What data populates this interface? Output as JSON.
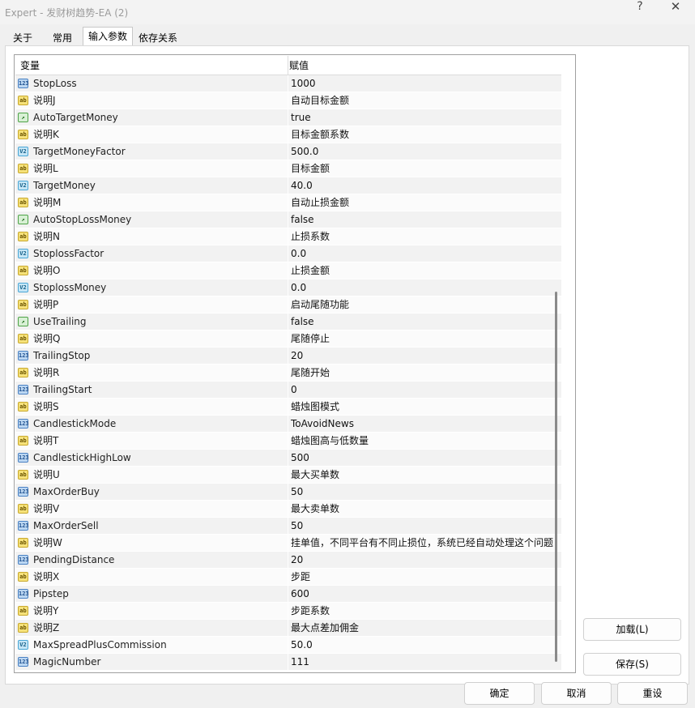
{
  "window": {
    "title": "Expert - 发财树趋势-EA (2)",
    "help_label": "?",
    "close_label": "✕"
  },
  "tabs": [
    {
      "label": "关于"
    },
    {
      "label": "常用"
    },
    {
      "label": "输入参数"
    },
    {
      "label": "依存关系"
    }
  ],
  "grid": {
    "col_variable": "变量",
    "col_value": "赋值",
    "rows": [
      {
        "name": "StopLoss",
        "value": "1000",
        "type": "int"
      },
      {
        "name": "说明J",
        "value": "自动目标金额",
        "type": "str"
      },
      {
        "name": "AutoTargetMoney",
        "value": "true",
        "type": "bool"
      },
      {
        "name": "说明K",
        "value": "目标金额系数",
        "type": "str"
      },
      {
        "name": "TargetMoneyFactor",
        "value": "500.0",
        "type": "dbl"
      },
      {
        "name": "说明L",
        "value": "目标金额",
        "type": "str"
      },
      {
        "name": "TargetMoney",
        "value": "40.0",
        "type": "dbl"
      },
      {
        "name": "说明M",
        "value": "自动止损金额",
        "type": "str"
      },
      {
        "name": "AutoStopLossMoney",
        "value": "false",
        "type": "bool"
      },
      {
        "name": "说明N",
        "value": "止损系数",
        "type": "str"
      },
      {
        "name": "StoplossFactor",
        "value": "0.0",
        "type": "dbl"
      },
      {
        "name": "说明O",
        "value": "止损金额",
        "type": "str"
      },
      {
        "name": "StoplossMoney",
        "value": "0.0",
        "type": "dbl"
      },
      {
        "name": "说明P",
        "value": "启动尾随功能",
        "type": "str"
      },
      {
        "name": "UseTrailing",
        "value": "false",
        "type": "bool"
      },
      {
        "name": "说明Q",
        "value": "尾随停止",
        "type": "str"
      },
      {
        "name": "TrailingStop",
        "value": "20",
        "type": "int"
      },
      {
        "name": "说明R",
        "value": "尾随开始",
        "type": "str"
      },
      {
        "name": "TrailingStart",
        "value": "0",
        "type": "int"
      },
      {
        "name": "说明S",
        "value": "蜡烛图模式",
        "type": "str"
      },
      {
        "name": "CandlestickMode",
        "value": "ToAvoidNews",
        "type": "int"
      },
      {
        "name": "说明T",
        "value": "蜡烛图高与低数量",
        "type": "str"
      },
      {
        "name": "CandlestickHighLow",
        "value": "500",
        "type": "int"
      },
      {
        "name": "说明U",
        "value": "最大买单数",
        "type": "str"
      },
      {
        "name": "MaxOrderBuy",
        "value": "50",
        "type": "int"
      },
      {
        "name": "说明V",
        "value": "最大卖单数",
        "type": "str"
      },
      {
        "name": "MaxOrderSell",
        "value": "50",
        "type": "int"
      },
      {
        "name": "说明W",
        "value": "挂单值，不同平台有不同止损位，系统已经自动处理这个问题",
        "type": "str"
      },
      {
        "name": "PendingDistance",
        "value": "20",
        "type": "int"
      },
      {
        "name": "说明X",
        "value": "步距",
        "type": "str"
      },
      {
        "name": "Pipstep",
        "value": "600",
        "type": "int"
      },
      {
        "name": "说明Y",
        "value": "步距系数",
        "type": "str"
      },
      {
        "name": "说明Z",
        "value": "最大点差加佣金",
        "type": "str"
      },
      {
        "name": "MaxSpreadPlusCommission",
        "value": "50.0",
        "type": "dbl"
      },
      {
        "name": "MagicNumber",
        "value": "111",
        "type": "int"
      }
    ]
  },
  "icons": {
    "str": {
      "glyph": "ab",
      "name": "string-type-icon"
    },
    "int": {
      "glyph": "123",
      "name": "integer-type-icon"
    },
    "dbl": {
      "glyph": "V2",
      "name": "double-type-icon"
    },
    "bool": {
      "glyph": "↗",
      "name": "boolean-type-icon"
    }
  },
  "buttons": {
    "load": "加载(L)",
    "save": "保存(S)",
    "ok": "确定",
    "cancel": "取消",
    "reset": "重设"
  }
}
